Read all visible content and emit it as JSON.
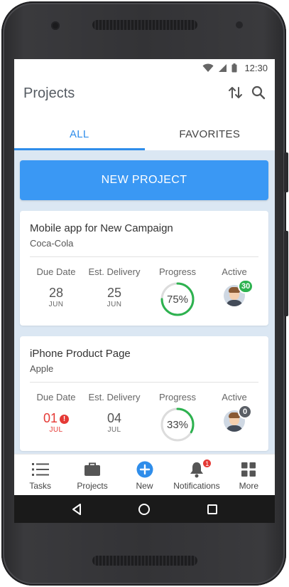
{
  "status_bar": {
    "time": "12:30"
  },
  "app_bar": {
    "title": "Projects",
    "icons": [
      "sort-icon",
      "search-icon"
    ]
  },
  "tabs": [
    {
      "label": "ALL",
      "active": true
    },
    {
      "label": "FAVORITES",
      "active": false
    }
  ],
  "new_project_label": "NEW PROJECT",
  "column_labels": {
    "due": "Due Date",
    "est": "Est. Delivery",
    "progress": "Progress",
    "active": "Active"
  },
  "projects": [
    {
      "name": "Mobile app for New Campaign",
      "client": "Coca-Cola",
      "due_day": "28",
      "due_month": "JUN",
      "due_overdue": false,
      "est_day": "25",
      "est_month": "JUN",
      "progress_text": "75%",
      "progress": 0.75,
      "active_count": "30",
      "active_badge_color": "#2db24f"
    },
    {
      "name": "iPhone Product Page",
      "client": "Apple",
      "due_day": "01",
      "due_month": "JUL",
      "due_overdue": true,
      "est_day": "04",
      "est_month": "JUL",
      "progress_text": "33%",
      "progress": 0.33,
      "active_count": "0",
      "active_badge_color": "#5a5f66"
    }
  ],
  "bottom_nav": [
    {
      "label": "Tasks",
      "icon": "list-icon"
    },
    {
      "label": "Projects",
      "icon": "briefcase-icon"
    },
    {
      "label": "New",
      "icon": "plus-circle-icon"
    },
    {
      "label": "Notifications",
      "icon": "bell-icon",
      "badge": "1"
    },
    {
      "label": "More",
      "icon": "grid-icon"
    }
  ],
  "colors": {
    "accent": "#2f8dea",
    "button": "#3a98f4",
    "progress": "#2db24f",
    "overdue": "#e53935",
    "content_bg": "#dbe7f3"
  }
}
